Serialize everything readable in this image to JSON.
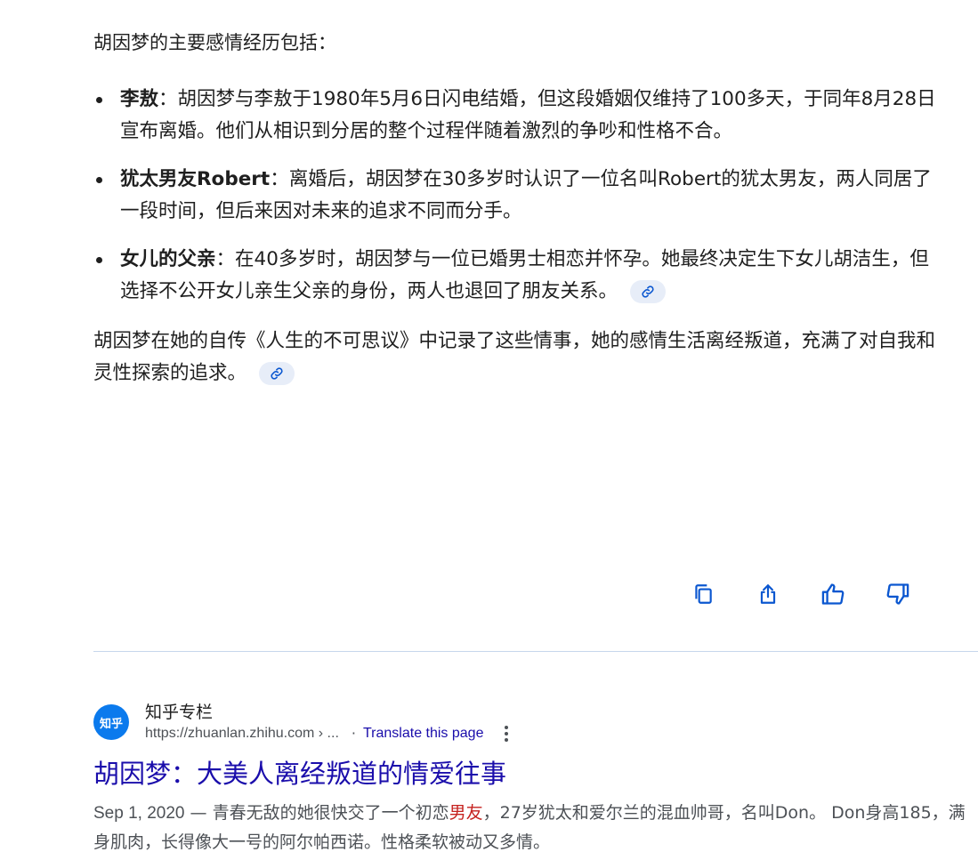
{
  "ai_overview": {
    "intro": "胡因梦的主要感情经历包括：",
    "items": [
      {
        "term": "李敖",
        "text": "：胡因梦与李敖于1980年5月6日闪电结婚，但这段婚姻仅维持了100多天，于同年8月28日宣布离婚。他们从相识到分居的整个过程伴随着激烈的争吵和性格不合。"
      },
      {
        "term": "犹太男友Robert",
        "text": "：离婚后，胡因梦在30多岁时认识了一位名叫Robert的犹太男友，两人同居了一段时间，但后来因对未来的追求不同而分手。"
      },
      {
        "term": "女儿的父亲",
        "text": "：在40多岁时，胡因梦与一位已婚男士相恋并怀孕。她最终决定生下女儿胡洁生，但选择不公开女儿亲生父亲的身份，两人也退回了朋友关系。"
      }
    ],
    "closing": "胡因梦在她的自传《人生的不可思议》中记录了这些情事，她的感情生活离经叛道，充满了对自我和灵性探索的追求。",
    "icons": {
      "citation": "link-icon"
    }
  },
  "feedback": {
    "icons": [
      "copy-icon",
      "share-icon",
      "thumbs-up-icon",
      "thumbs-down-icon"
    ],
    "accent": "#0b57d0"
  },
  "search_result": {
    "favicon_text": "知乎",
    "site_name": "知乎专栏",
    "url": "https://zhuanlan.zhihu.com › ...",
    "separator": "·",
    "translate": "Translate this page",
    "title": "胡因梦：大美人离经叛道的情爱往事",
    "snippet_date": "Sep 1, 2020",
    "snippet_dash": " — ",
    "snippet_pre": "青春无敌的她很快交了一个初恋",
    "snippet_highlight": "男友",
    "snippet_post": "，27岁犹太和爱尔兰的混血帅哥，名叫Don。 Don身高185，满身肌肉，长得像大一号的阿尔帕西诺。性格柔软被动又多情。",
    "colors": {
      "link": "#1a0dab",
      "highlight": "#c5221f",
      "favicon_bg": "#0b7aed"
    }
  }
}
